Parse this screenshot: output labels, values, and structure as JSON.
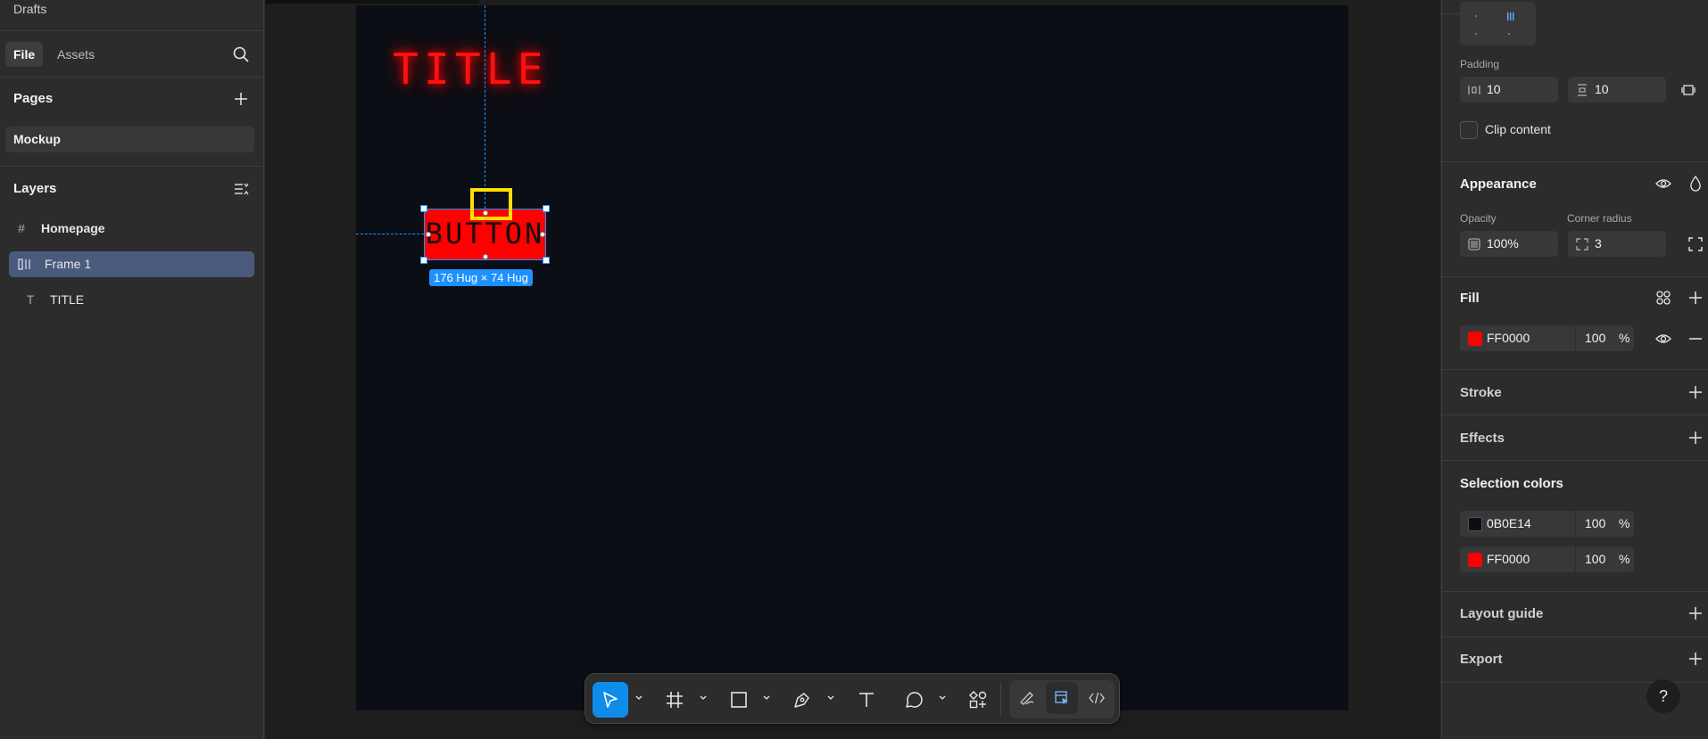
{
  "left": {
    "drafts_label": "Drafts",
    "tabs": [
      {
        "label": "File"
      },
      {
        "label": "Assets"
      }
    ],
    "pages_title": "Pages",
    "pages": [
      {
        "label": "Mockup"
      }
    ],
    "layers_title": "Layers",
    "layers": [
      {
        "label": "Homepage",
        "icon": "frame-hash-icon"
      },
      {
        "label": "Frame 1",
        "icon": "auto-layout-icon"
      },
      {
        "label": "TITLE",
        "icon": "text-icon"
      }
    ]
  },
  "canvas": {
    "frame_bg": "#0B0E14",
    "title_text": "TITLE",
    "button_text": "BUTTON",
    "size_label": "176 Hug × 74 Hug",
    "accent": "#FF0000",
    "selection_color": "#1E90FF"
  },
  "toolbar": {
    "tools": [
      "move-icon",
      "frame-icon",
      "rectangle-icon",
      "pen-icon",
      "text-icon",
      "comment-icon",
      "actions-icon"
    ],
    "modes": [
      "draw-mode-icon",
      "design-mode-icon",
      "dev-mode-icon"
    ]
  },
  "right": {
    "padding_label": "Padding",
    "padding_h": "10",
    "padding_v": "10",
    "clip_label": "Clip content",
    "appearance_title": "Appearance",
    "opacity_label": "Opacity",
    "opacity_value": "100%",
    "corner_label": "Corner radius",
    "corner_value": "3",
    "fill_title": "Fill",
    "fill_hex": "FF0000",
    "fill_opacity": "100",
    "pct": "%",
    "stroke_title": "Stroke",
    "effects_title": "Effects",
    "selection_colors_title": "Selection colors",
    "selection_colors": [
      {
        "hex": "0B0E14",
        "opacity": "100",
        "color": "#0B0E14"
      },
      {
        "hex": "FF0000",
        "opacity": "100",
        "color": "#FF0000"
      }
    ],
    "layout_guide_title": "Layout guide",
    "export_title": "Export",
    "help_label": "?"
  }
}
